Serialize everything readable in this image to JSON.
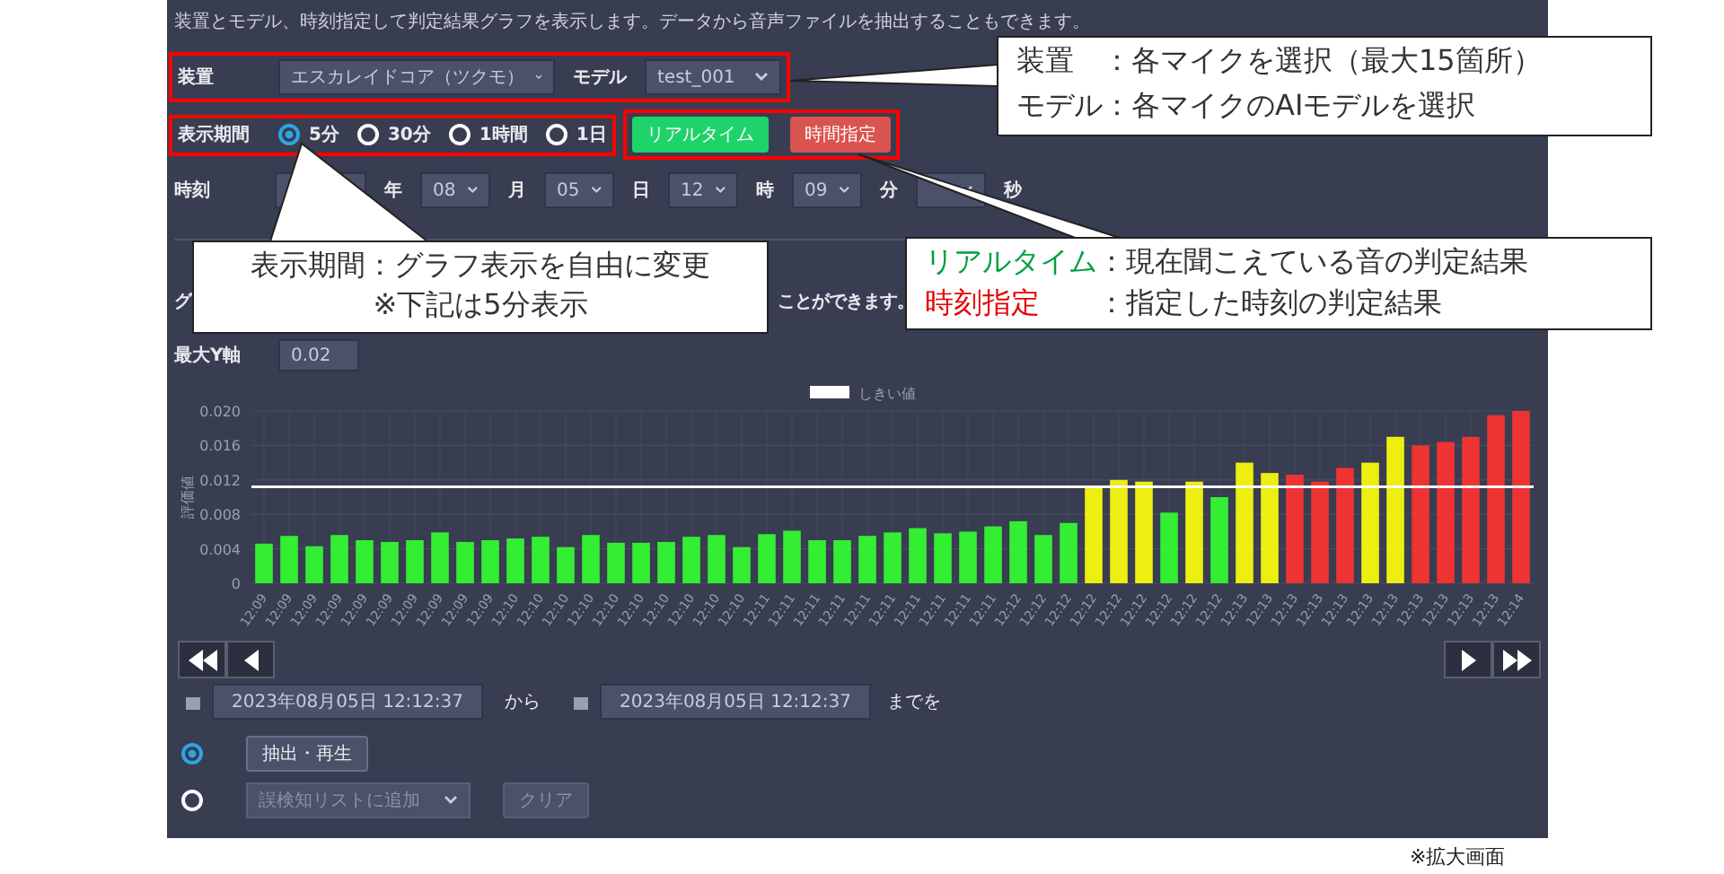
{
  "description": "装置とモデル、時刻指定して判定結果グラフを表示します。データから音声ファイルを抽出することもできます。",
  "device": {
    "label": "装置",
    "value": "エスカレイドコア（ツクモ）"
  },
  "model": {
    "label": "モデル",
    "value": "test_001"
  },
  "period": {
    "label": "表示期間",
    "options": [
      {
        "label": "5分",
        "selected": true
      },
      {
        "label": "30分",
        "selected": false
      },
      {
        "label": "1時間",
        "selected": false
      },
      {
        "label": "1日",
        "selected": false
      }
    ]
  },
  "mode_buttons": [
    {
      "label": "リアルタイム",
      "kind": "realtime"
    },
    {
      "label": "時間指定",
      "kind": "specified"
    }
  ],
  "time": {
    "label": "時刻",
    "fields": [
      {
        "unit": "年"
      },
      {
        "value": "08",
        "unit": "月"
      },
      {
        "value": "05",
        "unit": "日"
      },
      {
        "value": "12",
        "unit": "時"
      },
      {
        "value": "09",
        "unit": "分"
      },
      {
        "unit": "秒"
      }
    ]
  },
  "graph_text": [
    "グ",
    "ことができます。"
  ],
  "max_y": {
    "label": "最大Y軸",
    "value": "0.02"
  },
  "chart_data": {
    "type": "bar",
    "ylabel": "評価値",
    "ylim": [
      0,
      0.02
    ],
    "grid": true,
    "yticks": [
      {
        "value": 0,
        "label": "0"
      },
      {
        "value": 0.004,
        "label": "0.004"
      },
      {
        "value": 0.008,
        "label": "0.008"
      },
      {
        "value": 0.012,
        "label": "0.012"
      },
      {
        "value": 0.016,
        "label": "0.016"
      },
      {
        "value": 0.02,
        "label": "0.020"
      }
    ],
    "categories": [
      "12:09",
      "12:09",
      "12:09",
      "12:09",
      "12:09",
      "12:09",
      "12:09",
      "12:09",
      "12:09",
      "12:09",
      "12:10",
      "12:10",
      "12:10",
      "12:10",
      "12:10",
      "12:10",
      "12:10",
      "12:10",
      "12:10",
      "12:10",
      "12:11",
      "12:11",
      "12:11",
      "12:11",
      "12:11",
      "12:11",
      "12:11",
      "12:11",
      "12:11",
      "12:11",
      "12:12",
      "12:12",
      "12:12",
      "12:12",
      "12:12",
      "12:12",
      "12:12",
      "12:12",
      "12:12",
      "12:13",
      "12:13",
      "12:13",
      "12:13",
      "12:13",
      "12:13",
      "12:13",
      "12:13",
      "12:13",
      "12:13",
      "12:13",
      "12:14"
    ],
    "series": [
      {
        "color": "#33ee33",
        "values": [
          0.0046,
          0.0055,
          0.0043,
          0.0056,
          0.005,
          0.0048,
          0.005,
          0.0059,
          0.0048,
          0.005,
          0.0052,
          0.0054,
          0.0042,
          0.0056,
          0.0047,
          0.0047,
          0.0048,
          0.0054,
          0.0056,
          0.0042,
          0.0057,
          0.0061,
          0.005,
          0.005,
          0.0055,
          0.0059,
          0.0064,
          0.0058,
          0.006,
          0.0066,
          0.0072,
          0.0056,
          0.007,
          null,
          null,
          null,
          0.0082,
          null,
          0.01,
          null,
          null,
          null,
          null,
          null,
          null,
          null,
          null,
          null,
          null,
          null,
          null
        ]
      },
      {
        "color": "#eeee11",
        "values": [
          null,
          null,
          null,
          null,
          null,
          null,
          null,
          null,
          null,
          null,
          null,
          null,
          null,
          null,
          null,
          null,
          null,
          null,
          null,
          null,
          null,
          null,
          null,
          null,
          null,
          null,
          null,
          null,
          null,
          null,
          null,
          null,
          null,
          0.0113,
          0.012,
          0.0118,
          null,
          0.0118,
          null,
          0.014,
          0.0128,
          null,
          null,
          null,
          0.014,
          0.017,
          null,
          null,
          null,
          null,
          null
        ]
      },
      {
        "color": "#ee3333",
        "values": [
          null,
          null,
          null,
          null,
          null,
          null,
          null,
          null,
          null,
          null,
          null,
          null,
          null,
          null,
          null,
          null,
          null,
          null,
          null,
          null,
          null,
          null,
          null,
          null,
          null,
          null,
          null,
          null,
          null,
          null,
          null,
          null,
          null,
          null,
          null,
          null,
          null,
          null,
          null,
          null,
          null,
          0.0126,
          0.0118,
          0.0134,
          null,
          null,
          0.016,
          0.0164,
          0.017,
          0.0195,
          0.02
        ]
      }
    ],
    "ref_lines": [
      {
        "axis": "y",
        "value": 0.0112,
        "label": "しきい値"
      }
    ]
  },
  "nav_buttons": [
    {
      "kind": "first"
    },
    {
      "kind": "prev"
    },
    {
      "kind": "next"
    },
    {
      "kind": "last"
    }
  ],
  "range": {
    "from": "2023年08月05日 12:12:37",
    "from_suffix": "から",
    "to": "2023年08月05日 12:12:37",
    "to_suffix": "までを"
  },
  "actions": [
    {
      "selected": true,
      "controls": [
        {
          "kind": "button",
          "label": "抽出・再生",
          "disabled": false
        }
      ]
    },
    {
      "selected": false,
      "controls": [
        {
          "kind": "select",
          "label": "誤検知リストに追加",
          "disabled": true
        },
        {
          "kind": "button",
          "label": "クリア",
          "disabled": true
        }
      ]
    }
  ],
  "caption": "※拡大画面",
  "callouts": [
    {
      "kind": "terms",
      "items": [
        {
          "term": "装置",
          "text": "：各マイクを選択（最大15箇所）",
          "color": "#333333"
        },
        {
          "term": "モデル",
          "text": "：各マイクのAIモデルを選択",
          "color": "#333333"
        }
      ]
    },
    {
      "kind": "lines",
      "lines": [
        "表示期間：グラフ表示を自由に変更",
        "※下記は5分表示"
      ]
    },
    {
      "kind": "terms",
      "items": [
        {
          "term": "リアルタイム",
          "text": "：現在聞こえている音の判定結果",
          "color": "#00a040"
        },
        {
          "term": "時刻指定",
          "text": "：指定した時刻の判定結果",
          "color": "#e60000"
        }
      ]
    }
  ]
}
